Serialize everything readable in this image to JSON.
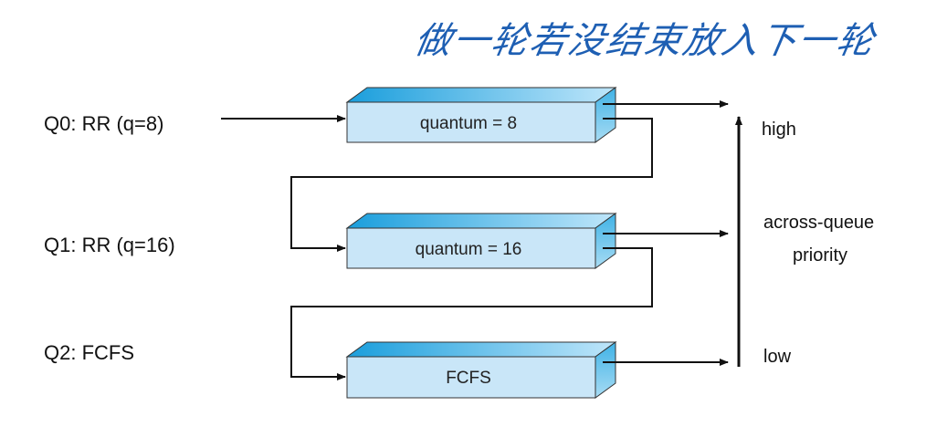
{
  "annotation": "做一轮若没结束放入下一轮",
  "queues": [
    {
      "label": "Q0: RR (q=8)",
      "box_text": "quantum = 8"
    },
    {
      "label": "Q1: RR (q=16)",
      "box_text": "quantum = 16"
    },
    {
      "label": "Q2: FCFS",
      "box_text": "FCFS"
    }
  ],
  "priority_axis": {
    "high": "high",
    "middle_line1": "across-queue",
    "middle_line2": "priority",
    "low": "low"
  },
  "colors": {
    "box_front": "#c9e6f8",
    "box_top": "#22a8e0",
    "box_side": "#5bbde8",
    "line": "#111111",
    "annotation": "#1e5fb3"
  }
}
